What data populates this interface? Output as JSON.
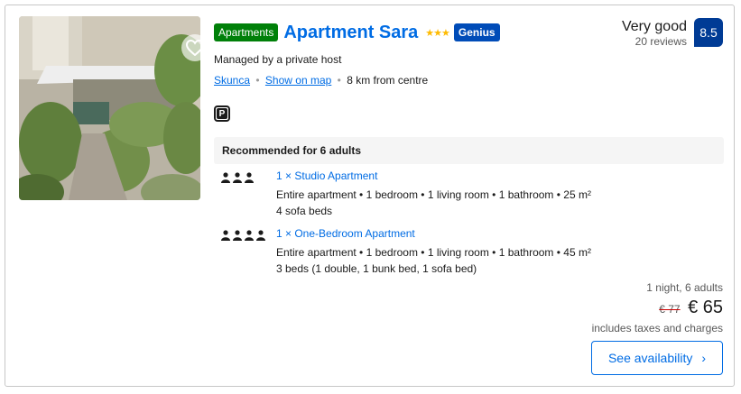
{
  "property": {
    "type_badge": "Apartments",
    "name": "Apartment Sara",
    "stars_glyph": "★★★",
    "genius_label": "Genius",
    "host": "Managed by a private host",
    "location_link": "Skunca",
    "map_link": "Show on map",
    "distance": "8 km from centre",
    "facility_icon": "parking-icon",
    "facility_glyph": "P"
  },
  "review": {
    "word": "Very good",
    "count": "20 reviews",
    "score": "8.5"
  },
  "recommendation": {
    "heading": "Recommended for 6 adults",
    "units": [
      {
        "name": "1 × Studio Apartment",
        "occupancy": 3,
        "details": "Entire apartment • 1 bedroom • 1 living room • 1 bathroom • 25 m²",
        "beds": "4 sofa beds"
      },
      {
        "name": "1 × One-Bedroom Apartment",
        "occupancy": 4,
        "details": "Entire apartment • 1 bedroom • 1 living room • 1 bathroom • 45 m²",
        "beds": "3 beds (1 double, 1 bunk bed, 1 sofa bed)"
      }
    ]
  },
  "price": {
    "stay": "1 night, 6 adults",
    "original": "€ 77",
    "current": "€ 65",
    "taxes_note": "includes taxes and charges"
  },
  "cta": {
    "label": "See availability",
    "chevron": "›"
  },
  "colors": {
    "link": "#006ce4",
    "score_bg": "#003b95",
    "badge_green": "#008009",
    "genius_bg": "#004cb8",
    "star": "#febb02"
  }
}
